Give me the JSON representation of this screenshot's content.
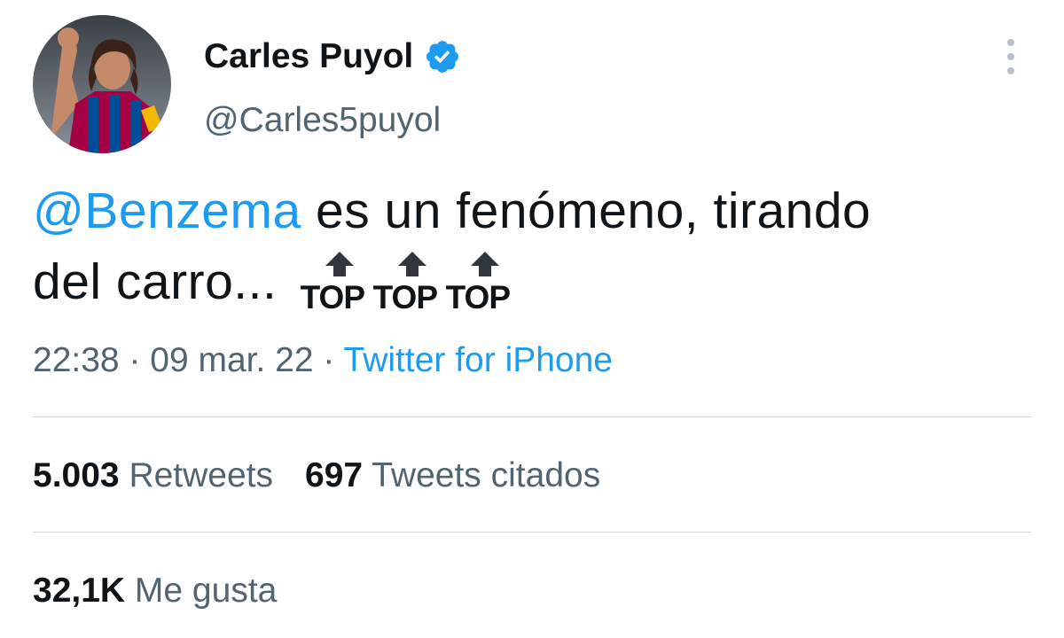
{
  "user": {
    "name": "Carles Puyol",
    "handle": "@Carles5puyol",
    "verified_icon": "verified-badge-icon",
    "avatar_colors": {
      "jersey_red": "#a50044",
      "jersey_blue": "#004d98",
      "captain_band": "#f5b800"
    }
  },
  "tweet": {
    "mention": "@Benzema",
    "text_line1": " es un fenómeno, tirando",
    "text_line2": "del carro... ",
    "emoji": [
      {
        "icon": "top-arrow-emoji",
        "label": "TOP"
      },
      {
        "icon": "top-arrow-emoji",
        "label": "TOP"
      },
      {
        "icon": "top-arrow-emoji",
        "label": "TOP"
      }
    ]
  },
  "meta": {
    "time": "22:38",
    "sep1": " · ",
    "date": "09 mar. 22",
    "sep2": " · ",
    "source": "Twitter for iPhone"
  },
  "stats": {
    "retweets_count": "5.003",
    "retweets_label": "Retweets",
    "quotes_count": "697",
    "quotes_label": "Tweets citados",
    "likes_count": "32,1K",
    "likes_label": "Me gusta"
  },
  "colors": {
    "text_primary": "#0f1419",
    "text_secondary": "#536471",
    "accent": "#1d9bf0",
    "divider": "#cfd9de"
  }
}
